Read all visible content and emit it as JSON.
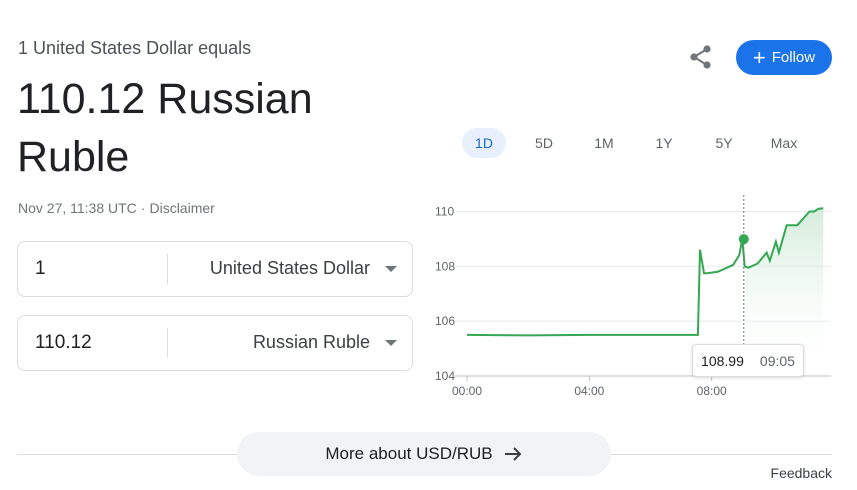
{
  "header": {
    "equals_label": "1 United States Dollar equals",
    "rate_text": "110.12 Russian Ruble",
    "timestamp": "Nov 27, 11:38 UTC",
    "separator": "·",
    "disclaimer": "Disclaimer"
  },
  "actions": {
    "follow_label": "Follow",
    "share_icon": "share-icon",
    "follow_icon": "plus-icon"
  },
  "converter": {
    "from": {
      "value": "1",
      "currency": "United States Dollar"
    },
    "to": {
      "value": "110.12",
      "currency": "Russian Ruble"
    }
  },
  "ranges": [
    {
      "label": "1D",
      "active": true
    },
    {
      "label": "5D",
      "active": false
    },
    {
      "label": "1M",
      "active": false
    },
    {
      "label": "1Y",
      "active": false
    },
    {
      "label": "5Y",
      "active": false
    },
    {
      "label": "Max",
      "active": false
    }
  ],
  "tooltip": {
    "value": "108.99",
    "time": "09:05"
  },
  "more_link": {
    "label": "More about USD/RUB",
    "icon": "arrow-right-icon"
  },
  "feedback": "Feedback",
  "colors": {
    "accent": "#1a73e8",
    "line": "#34a853",
    "fill": "#e6f4ea"
  },
  "chart_data": {
    "type": "line",
    "x_ticks": [
      "00:00",
      "04:00",
      "08:00"
    ],
    "y_ticks": [
      104,
      106,
      108,
      110
    ],
    "ylim": [
      104,
      110.6
    ],
    "xlim": [
      0,
      11.65
    ],
    "series": [
      {
        "x": [
          0,
          2.0,
          4.0,
          6.0,
          7.55,
          7.62,
          7.75,
          7.85,
          8.2,
          8.6,
          8.7,
          8.9,
          9.0,
          9.08,
          9.2,
          9.5,
          9.8,
          9.9,
          10.1,
          10.2,
          10.45,
          10.5,
          10.8,
          11.2,
          11.35,
          11.5,
          11.65
        ],
        "y": [
          105.5,
          105.48,
          105.5,
          105.5,
          105.5,
          108.6,
          107.75,
          107.75,
          107.8,
          108.0,
          108.05,
          108.4,
          108.99,
          108.0,
          107.95,
          108.1,
          108.5,
          108.2,
          108.9,
          108.5,
          109.5,
          109.5,
          109.5,
          110.0,
          110.0,
          110.1,
          110.12
        ]
      }
    ],
    "highlight": {
      "x": 9.05,
      "y": 108.99
    },
    "grid": true
  }
}
